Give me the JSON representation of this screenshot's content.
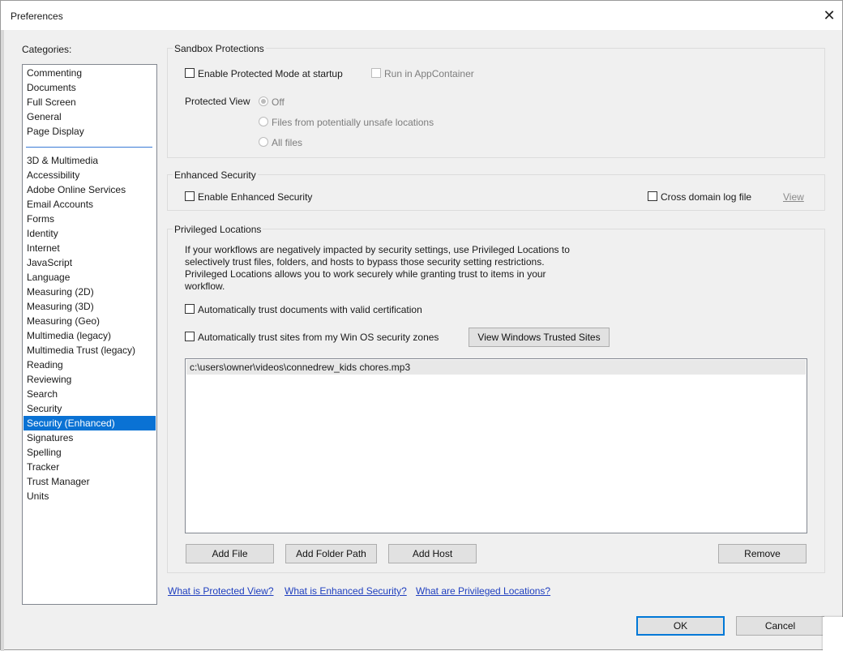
{
  "window": {
    "title": "Preferences",
    "close_glyph": "✕"
  },
  "categories": {
    "label": "Categories:",
    "group1": [
      "Commenting",
      "Documents",
      "Full Screen",
      "General",
      "Page Display"
    ],
    "group2": [
      "3D & Multimedia",
      "Accessibility",
      "Adobe Online Services",
      "Email Accounts",
      "Forms",
      "Identity",
      "Internet",
      "JavaScript",
      "Language",
      "Measuring (2D)",
      "Measuring (3D)",
      "Measuring (Geo)",
      "Multimedia (legacy)",
      "Multimedia Trust (legacy)",
      "Reading",
      "Reviewing",
      "Search",
      "Security",
      "Security (Enhanced)",
      "Signatures",
      "Spelling",
      "Tracker",
      "Trust Manager",
      "Units"
    ],
    "selected": "Security (Enhanced)"
  },
  "sandbox": {
    "title": "Sandbox Protections",
    "protected_mode_label": "Enable Protected Mode at startup",
    "protected_mode_checked": false,
    "appcontainer_label": "Run in AppContainer",
    "appcontainer_checked": false,
    "protected_view_label": "Protected View",
    "protected_view_options": [
      "Off",
      "Files from potentially unsafe locations",
      "All files"
    ],
    "protected_view_selected": "Off"
  },
  "enhanced": {
    "title": "Enhanced Security",
    "enable_label": "Enable Enhanced Security",
    "enable_checked": false,
    "cross_domain_label": "Cross domain log file",
    "cross_domain_checked": false,
    "view_link": "View"
  },
  "privileged": {
    "title": "Privileged Locations",
    "description_lines": [
      "If your workflows are negatively impacted by security settings, use Privileged Locations to",
      "selectively trust files, folders, and hosts to bypass those security setting restrictions.",
      "Privileged Locations allows you to work securely while granting trust to items in your",
      "workflow."
    ],
    "trust_cert_label": "Automatically trust documents with valid certification",
    "trust_cert_checked": false,
    "trust_sites_label": "Automatically trust sites from my Win OS security zones",
    "trust_sites_checked": false,
    "view_trusted_sites_button": "View Windows Trusted Sites",
    "locations": [
      "c:\\users\\owner\\videos\\connedrew_kids chores.mp3"
    ],
    "add_file_button": "Add File",
    "add_folder_button": "Add Folder Path",
    "add_host_button": "Add Host",
    "remove_button": "Remove"
  },
  "links": {
    "protected_view": "What is Protected View?",
    "enhanced_security": "What is Enhanced Security?",
    "privileged_locations": "What are Privileged Locations?"
  },
  "footer": {
    "ok_button": "OK",
    "cancel_button": "Cancel"
  },
  "colors": {
    "selection": "#0a72d4",
    "link": "#1f3fbf",
    "default_button_border": "#0078d7"
  }
}
